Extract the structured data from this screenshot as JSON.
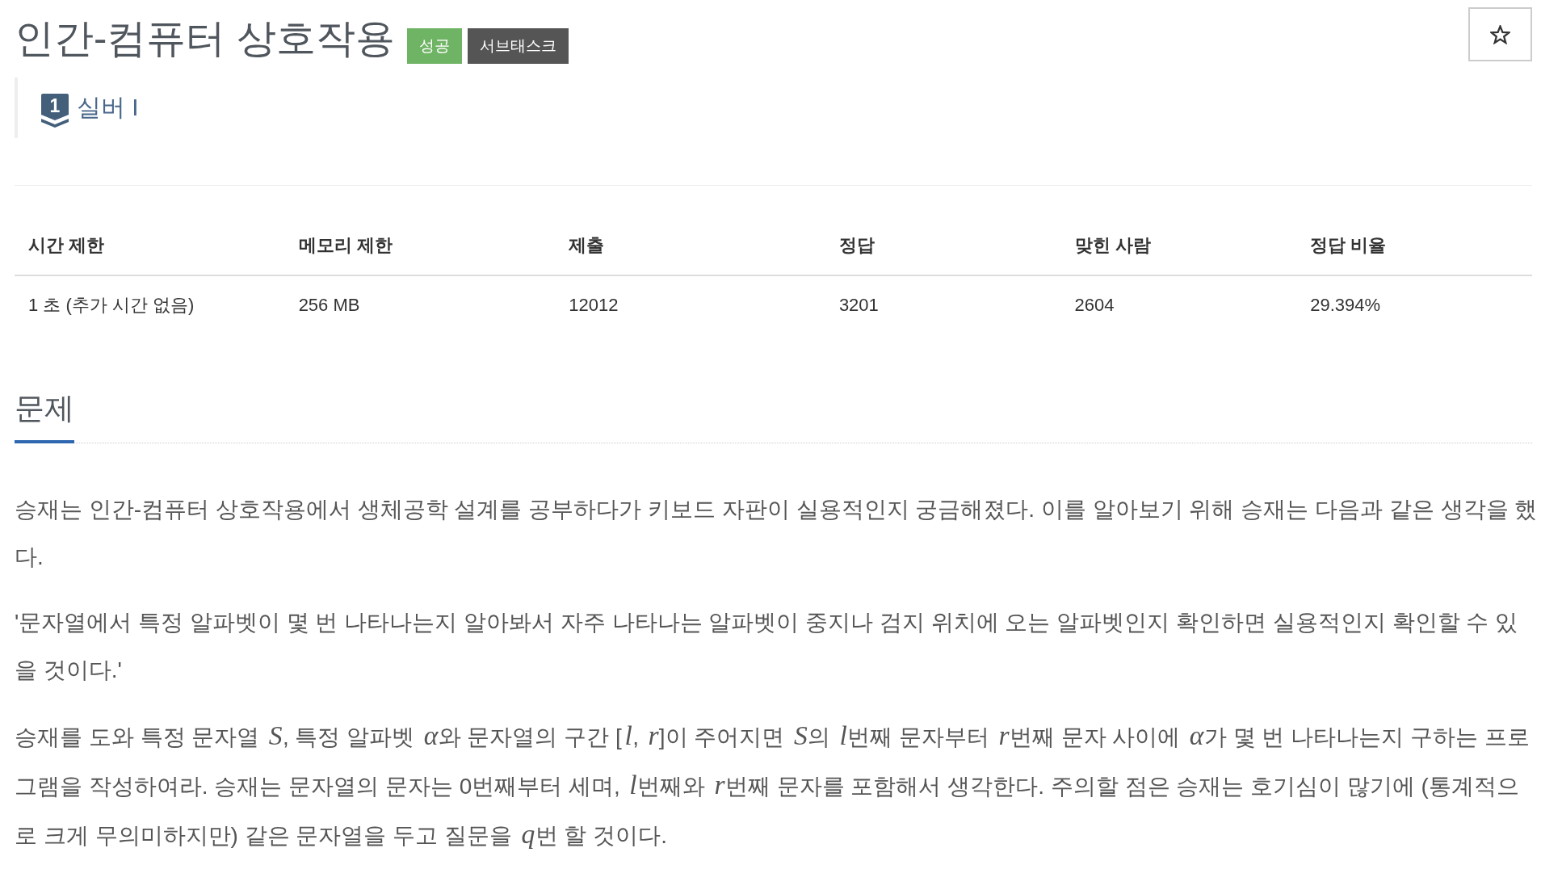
{
  "problem": {
    "title": "인간-컴퓨터 상호작용",
    "labels": [
      {
        "text": "성공",
        "color": "#6fb464"
      },
      {
        "text": "서브태스크",
        "color": "#555555"
      }
    ],
    "starred": false
  },
  "tier": {
    "number": "1",
    "name": "실버 I"
  },
  "stats": {
    "columns": [
      "시간 제한",
      "메모리 제한",
      "제출",
      "정답",
      "맞힌 사람",
      "정답 비율"
    ],
    "rows": [
      [
        "1 초 (추가 시간 없음)",
        "256 MB",
        "12012",
        "3201",
        "2604",
        "29.394%"
      ]
    ]
  },
  "section": {
    "heading": "문제",
    "paragraphs": [
      {
        "runs": [
          {
            "kind": "text",
            "text": "승재는 인간-컴퓨터 상호작용에서 생체공학 설계를 공부하다가 키보드 자판이 실용적인지 궁금해졌다. 이를 알아보기 위해 승재는 다음과 같은 생각을 했다."
          }
        ]
      },
      {
        "runs": [
          {
            "kind": "text",
            "text": "'문자열에서 특정 알파벳이 몇 번 나타나는지 알아봐서 자주 나타나는 알파벳이 중지나 검지 위치에 오는 알파벳인지 확인하면 실용적인지 확인할 수 있을 것이다.'"
          }
        ]
      },
      {
        "runs": [
          {
            "kind": "text",
            "text": "승재를 도와 특정 문자열 "
          },
          {
            "kind": "math",
            "text": "S"
          },
          {
            "kind": "text",
            "text": ", 특정 알파벳 "
          },
          {
            "kind": "math",
            "text": "α"
          },
          {
            "kind": "text",
            "text": "와 문자열의 구간 ["
          },
          {
            "kind": "math",
            "text": "l"
          },
          {
            "kind": "text",
            "text": ", "
          },
          {
            "kind": "math",
            "text": "r"
          },
          {
            "kind": "text",
            "text": "]이 주어지면 "
          },
          {
            "kind": "math",
            "text": "S"
          },
          {
            "kind": "text",
            "text": "의 "
          },
          {
            "kind": "math",
            "text": "l"
          },
          {
            "kind": "text",
            "text": "번째 문자부터 "
          },
          {
            "kind": "math",
            "text": "r"
          },
          {
            "kind": "text",
            "text": "번째 문자 사이에 "
          },
          {
            "kind": "math",
            "text": "α"
          },
          {
            "kind": "text",
            "text": "가 몇 번 나타나는지 구하는 프로그램을 작성하여라. 승재는 문자열의 문자는 0번째부터 세며, "
          },
          {
            "kind": "math",
            "text": "l"
          },
          {
            "kind": "text",
            "text": "번째와 "
          },
          {
            "kind": "math",
            "text": "r"
          },
          {
            "kind": "text",
            "text": "번째 문자를 포함해서 생각한다. 주의할 점은 승재는 호기심이 많기에 (통계적으로 크게 무의미하지만) 같은 문자열을 두고 질문을 "
          },
          {
            "kind": "math",
            "text": "q"
          },
          {
            "kind": "text",
            "text": "번 할 것이다."
          }
        ]
      }
    ]
  }
}
